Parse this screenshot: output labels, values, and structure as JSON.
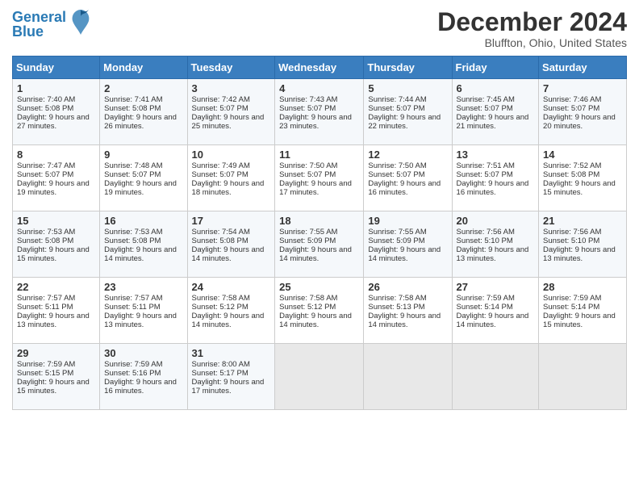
{
  "header": {
    "logo_line1": "General",
    "logo_line2": "Blue",
    "month_title": "December 2024",
    "location": "Bluffton, Ohio, United States"
  },
  "days_of_week": [
    "Sunday",
    "Monday",
    "Tuesday",
    "Wednesday",
    "Thursday",
    "Friday",
    "Saturday"
  ],
  "weeks": [
    [
      {
        "day": "1",
        "sunrise": "7:40 AM",
        "sunset": "5:08 PM",
        "daylight": "9 hours and 27 minutes."
      },
      {
        "day": "2",
        "sunrise": "7:41 AM",
        "sunset": "5:08 PM",
        "daylight": "9 hours and 26 minutes."
      },
      {
        "day": "3",
        "sunrise": "7:42 AM",
        "sunset": "5:07 PM",
        "daylight": "9 hours and 25 minutes."
      },
      {
        "day": "4",
        "sunrise": "7:43 AM",
        "sunset": "5:07 PM",
        "daylight": "9 hours and 23 minutes."
      },
      {
        "day": "5",
        "sunrise": "7:44 AM",
        "sunset": "5:07 PM",
        "daylight": "9 hours and 22 minutes."
      },
      {
        "day": "6",
        "sunrise": "7:45 AM",
        "sunset": "5:07 PM",
        "daylight": "9 hours and 21 minutes."
      },
      {
        "day": "7",
        "sunrise": "7:46 AM",
        "sunset": "5:07 PM",
        "daylight": "9 hours and 20 minutes."
      }
    ],
    [
      {
        "day": "8",
        "sunrise": "7:47 AM",
        "sunset": "5:07 PM",
        "daylight": "9 hours and 19 minutes."
      },
      {
        "day": "9",
        "sunrise": "7:48 AM",
        "sunset": "5:07 PM",
        "daylight": "9 hours and 19 minutes."
      },
      {
        "day": "10",
        "sunrise": "7:49 AM",
        "sunset": "5:07 PM",
        "daylight": "9 hours and 18 minutes."
      },
      {
        "day": "11",
        "sunrise": "7:50 AM",
        "sunset": "5:07 PM",
        "daylight": "9 hours and 17 minutes."
      },
      {
        "day": "12",
        "sunrise": "7:50 AM",
        "sunset": "5:07 PM",
        "daylight": "9 hours and 16 minutes."
      },
      {
        "day": "13",
        "sunrise": "7:51 AM",
        "sunset": "5:07 PM",
        "daylight": "9 hours and 16 minutes."
      },
      {
        "day": "14",
        "sunrise": "7:52 AM",
        "sunset": "5:08 PM",
        "daylight": "9 hours and 15 minutes."
      }
    ],
    [
      {
        "day": "15",
        "sunrise": "7:53 AM",
        "sunset": "5:08 PM",
        "daylight": "9 hours and 15 minutes."
      },
      {
        "day": "16",
        "sunrise": "7:53 AM",
        "sunset": "5:08 PM",
        "daylight": "9 hours and 14 minutes."
      },
      {
        "day": "17",
        "sunrise": "7:54 AM",
        "sunset": "5:08 PM",
        "daylight": "9 hours and 14 minutes."
      },
      {
        "day": "18",
        "sunrise": "7:55 AM",
        "sunset": "5:09 PM",
        "daylight": "9 hours and 14 minutes."
      },
      {
        "day": "19",
        "sunrise": "7:55 AM",
        "sunset": "5:09 PM",
        "daylight": "9 hours and 14 minutes."
      },
      {
        "day": "20",
        "sunrise": "7:56 AM",
        "sunset": "5:10 PM",
        "daylight": "9 hours and 13 minutes."
      },
      {
        "day": "21",
        "sunrise": "7:56 AM",
        "sunset": "5:10 PM",
        "daylight": "9 hours and 13 minutes."
      }
    ],
    [
      {
        "day": "22",
        "sunrise": "7:57 AM",
        "sunset": "5:11 PM",
        "daylight": "9 hours and 13 minutes."
      },
      {
        "day": "23",
        "sunrise": "7:57 AM",
        "sunset": "5:11 PM",
        "daylight": "9 hours and 13 minutes."
      },
      {
        "day": "24",
        "sunrise": "7:58 AM",
        "sunset": "5:12 PM",
        "daylight": "9 hours and 14 minutes."
      },
      {
        "day": "25",
        "sunrise": "7:58 AM",
        "sunset": "5:12 PM",
        "daylight": "9 hours and 14 minutes."
      },
      {
        "day": "26",
        "sunrise": "7:58 AM",
        "sunset": "5:13 PM",
        "daylight": "9 hours and 14 minutes."
      },
      {
        "day": "27",
        "sunrise": "7:59 AM",
        "sunset": "5:14 PM",
        "daylight": "9 hours and 14 minutes."
      },
      {
        "day": "28",
        "sunrise": "7:59 AM",
        "sunset": "5:14 PM",
        "daylight": "9 hours and 15 minutes."
      }
    ],
    [
      {
        "day": "29",
        "sunrise": "7:59 AM",
        "sunset": "5:15 PM",
        "daylight": "9 hours and 15 minutes."
      },
      {
        "day": "30",
        "sunrise": "7:59 AM",
        "sunset": "5:16 PM",
        "daylight": "9 hours and 16 minutes."
      },
      {
        "day": "31",
        "sunrise": "8:00 AM",
        "sunset": "5:17 PM",
        "daylight": "9 hours and 17 minutes."
      },
      null,
      null,
      null,
      null
    ]
  ]
}
